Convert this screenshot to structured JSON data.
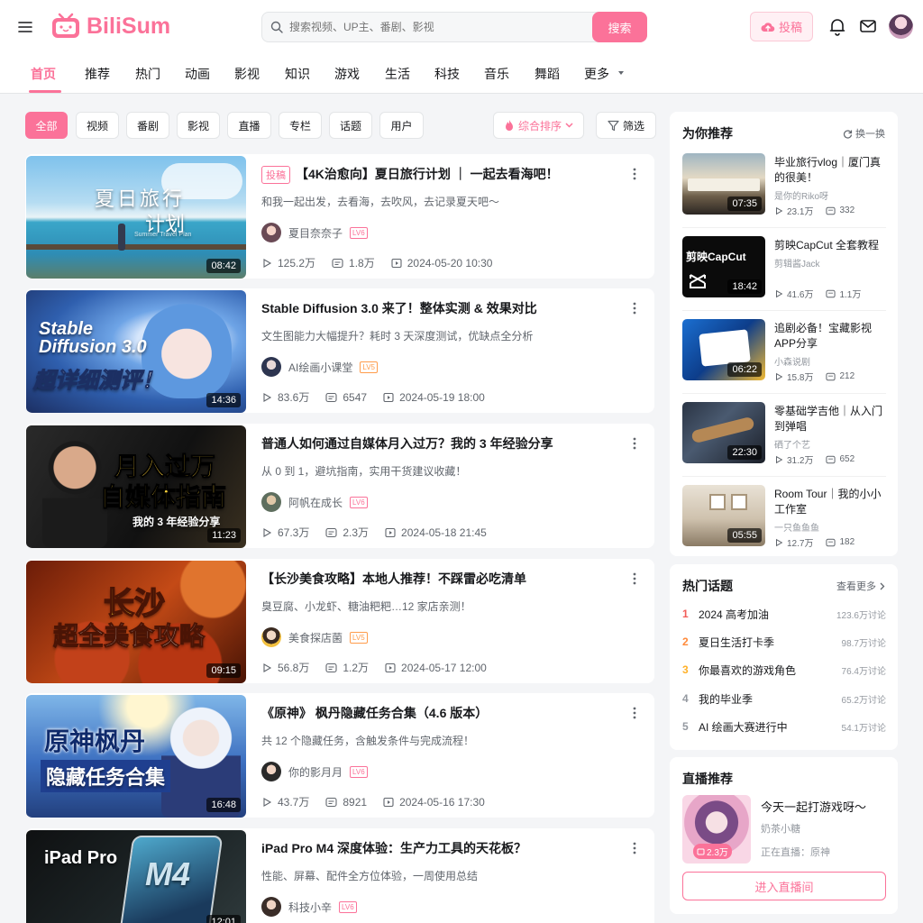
{
  "header": {
    "logo_text": "BiliSum",
    "search_placeholder": "搜索视频、UP主、番剧、影视",
    "search_button": "搜索",
    "upload_button": "投稿",
    "accent_color": "#fb7299"
  },
  "nav": {
    "items": [
      "首页",
      "推荐",
      "热门",
      "动画",
      "影视",
      "知识",
      "游戏",
      "生活",
      "科技",
      "音乐",
      "舞蹈",
      "更多"
    ],
    "active_index": 0
  },
  "filters": {
    "chips": [
      "全部",
      "视频",
      "番剧",
      "影视",
      "直播",
      "专栏",
      "话题",
      "用户"
    ],
    "active_index": 0,
    "sort_label": "综合排序",
    "filter_label": "筛选"
  },
  "videos": [
    {
      "tag": "投稿",
      "title": "【4K治愈向】夏日旅行计划 ｜ 一起去看海吧！",
      "desc": "和我一起出发，去看海，去吹风，去记录夏天吧～",
      "uploader": "夏目奈奈子",
      "level": "LV6",
      "views": "125.2万",
      "danmaku": "1.8万",
      "date": "2024-05-20 10:30",
      "duration": "08:42",
      "thumb_text_1": "夏日旅行",
      "thumb_text_2": "计划",
      "thumb_text_3": "Summer Travel Plan"
    },
    {
      "tag": "",
      "title": "Stable Diffusion 3.0 来了！整体实测 & 效果对比",
      "desc": "文生图能力大幅提升？耗时 3 天深度测试，优缺点全分析",
      "uploader": "AI绘画小课堂",
      "level": "LV5",
      "views": "83.6万",
      "danmaku": "6547",
      "date": "2024-05-19 18:00",
      "duration": "14:36",
      "thumb_text_1": "Stable",
      "thumb_text_2": "Diffusion 3.0",
      "thumb_text_3": "超详细测评！"
    },
    {
      "tag": "",
      "title": "普通人如何通过自媒体月入过万？我的 3 年经验分享",
      "desc": "从 0 到 1，避坑指南，实用干货建议收藏！",
      "uploader": "阿帆在成长",
      "level": "LV6",
      "views": "67.3万",
      "danmaku": "2.3万",
      "date": "2024-05-18 21:45",
      "duration": "11:23",
      "thumb_text_1": "月入过万",
      "thumb_text_2": "自媒体指南",
      "thumb_text_3": "我的 3 年经验分享"
    },
    {
      "tag": "",
      "title": "【长沙美食攻略】本地人推荐！不踩雷必吃清单",
      "desc": "臭豆腐、小龙虾、糖油粑粑…12 家店亲测！",
      "uploader": "美食探店菌",
      "level": "LV5",
      "views": "56.8万",
      "danmaku": "1.2万",
      "date": "2024-05-17 12:00",
      "duration": "09:15",
      "thumb_text_1": "长沙",
      "thumb_text_2": "超全美食攻略",
      "thumb_text_3": ""
    },
    {
      "tag": "",
      "title": "《原神》 枫丹隐藏任务合集（4.6 版本）",
      "desc": "共 12 个隐藏任务，含触发条件与完成流程！",
      "uploader": "你的影月月",
      "level": "LV6",
      "views": "43.7万",
      "danmaku": "8921",
      "date": "2024-05-16 17:30",
      "duration": "16:48",
      "thumb_text_1": "原神枫丹",
      "thumb_text_2": "隐藏任务合集",
      "thumb_text_3": ""
    },
    {
      "tag": "",
      "title": "iPad Pro M4 深度体验：生产力工具的天花板？",
      "desc": "性能、屏幕、配件全方位体验，一周使用总结",
      "uploader": "科技小辛",
      "level": "LV6",
      "views": "",
      "danmaku": "",
      "date": "",
      "duration": "12:01",
      "thumb_text_1": "iPad Pro",
      "thumb_text_2": "M4",
      "thumb_text_3": ""
    }
  ],
  "recommend": {
    "title": "为你推荐",
    "refresh_label": "换一换",
    "items": [
      {
        "title": "毕业旅行vlog｜厦门真的很美！",
        "uploader": "是你的Riko呀",
        "views": "23.1万",
        "danmaku": "332",
        "duration": "07:35"
      },
      {
        "title": "剪映CapCut 全套教程",
        "uploader": "剪辑酱Jack",
        "views": "41.6万",
        "danmaku": "1.1万",
        "duration": "18:42",
        "thumb_text": "剪映CapCut"
      },
      {
        "title": "追剧必备！宝藏影视APP分享",
        "uploader": "小森说剧",
        "views": "15.8万",
        "danmaku": "212",
        "duration": "06:22"
      },
      {
        "title": "零基础学吉他｜从入门到弹唱",
        "uploader": "硒了个艺",
        "views": "31.2万",
        "danmaku": "652",
        "duration": "22:30"
      },
      {
        "title": "Room Tour｜我的小小工作室",
        "uploader": "一只鱼鱼鱼",
        "views": "12.7万",
        "danmaku": "182",
        "duration": "05:55"
      }
    ]
  },
  "hot_topics": {
    "title": "热门话题",
    "more_label": "查看更多",
    "items": [
      {
        "rank": "1",
        "name": "2024 高考加油",
        "count": "123.6万讨论"
      },
      {
        "rank": "2",
        "name": "夏日生活打卡季",
        "count": "98.7万讨论"
      },
      {
        "rank": "3",
        "name": "你最喜欢的游戏角色",
        "count": "76.4万讨论"
      },
      {
        "rank": "4",
        "name": "我的毕业季",
        "count": "65.2万讨论"
      },
      {
        "rank": "5",
        "name": "AI 绘画大赛进行中",
        "count": "54.1万讨论"
      }
    ]
  },
  "live": {
    "title": "直播推荐",
    "stream_title": "今天一起打游戏呀～",
    "streamer": "奶茶小糖",
    "status": "正在直播：原神",
    "viewers": "2.3万",
    "button": "进入直播间"
  }
}
